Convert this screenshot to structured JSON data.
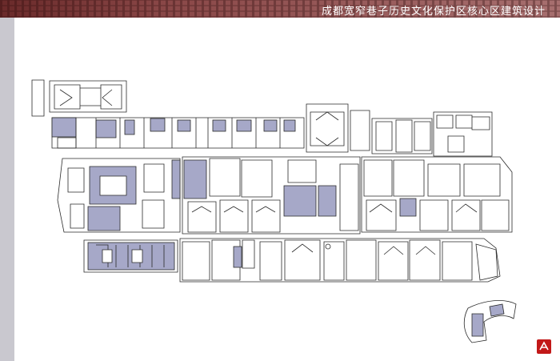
{
  "header": {
    "title": "成都宽窄巷子历史文化保护区核心区建筑设计"
  },
  "colors": {
    "header_band": "#7a3838",
    "left_band": "#c9c8cf",
    "highlight_fill": "#a6a8c8",
    "line": "#2a2a2a",
    "logo_red": "#c21818"
  },
  "logo": {
    "icon": "red-seal-logo-icon"
  }
}
